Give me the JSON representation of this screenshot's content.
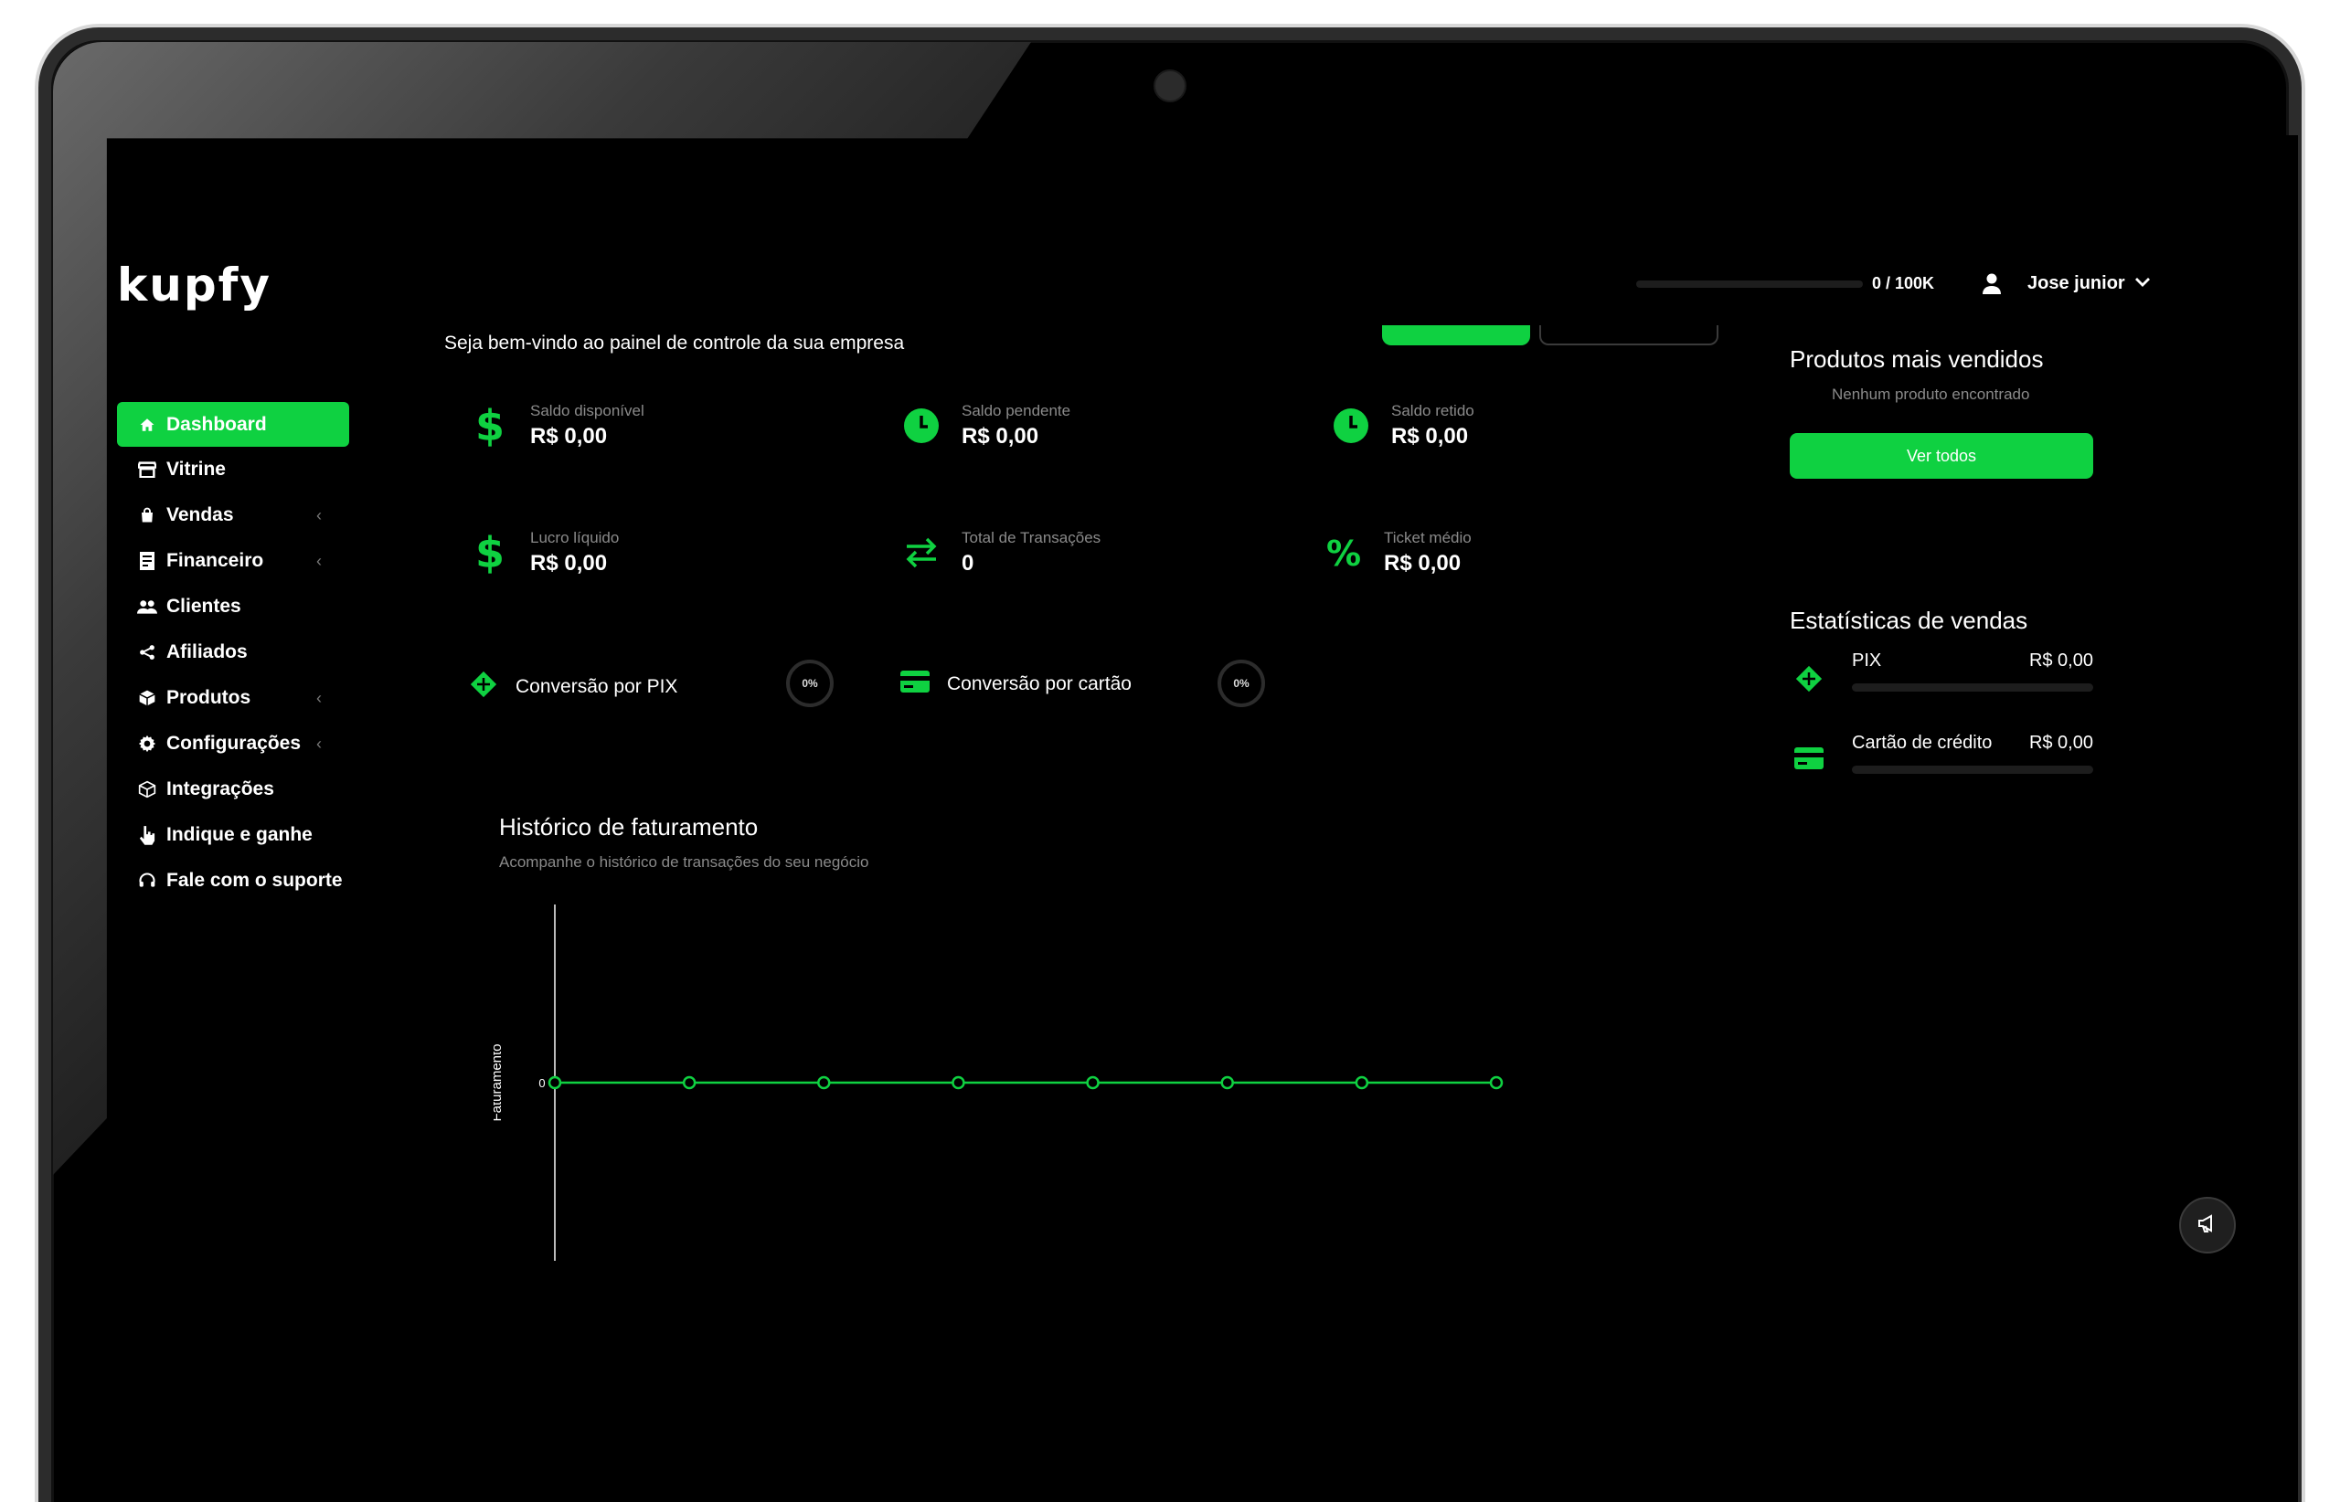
{
  "brand": {
    "logo_text": "kupfy"
  },
  "header": {
    "usage": "0 / 100K",
    "usage_fraction": 0,
    "user_name": "Jose junior"
  },
  "welcome": "Seja bem-vindo ao painel de controle da sua empresa",
  "sidebar": {
    "items": [
      {
        "label": "Dashboard",
        "icon": "home-icon",
        "active": true
      },
      {
        "label": "Vitrine",
        "icon": "store-icon"
      },
      {
        "label": "Vendas",
        "icon": "bag-icon",
        "has_submenu": true
      },
      {
        "label": "Financeiro",
        "icon": "receipt-icon",
        "has_submenu": true
      },
      {
        "label": "Clientes",
        "icon": "users-icon"
      },
      {
        "label": "Afiliados",
        "icon": "share-icon"
      },
      {
        "label": "Produtos",
        "icon": "box-icon",
        "has_submenu": true
      },
      {
        "label": "Configurações",
        "icon": "gear-icon",
        "has_submenu": true
      },
      {
        "label": "Integrações",
        "icon": "cube-icon"
      },
      {
        "label": "Indique e ganhe",
        "icon": "hand-pointer-icon"
      },
      {
        "label": "Fale com o suporte",
        "icon": "headset-icon"
      }
    ],
    "submenu_chevron": "‹"
  },
  "stats": [
    {
      "label": "Saldo disponível",
      "value": "R$ 0,00",
      "icon": "dollar-icon"
    },
    {
      "label": "Saldo pendente",
      "value": "R$ 0,00",
      "icon": "clock-icon"
    },
    {
      "label": "Saldo retido",
      "value": "R$ 0,00",
      "icon": "clock-icon"
    },
    {
      "label": "Lucro líquido",
      "value": "R$ 0,00",
      "icon": "dollar-icon"
    },
    {
      "label": "Total de Transações",
      "value": "0",
      "icon": "transfer-icon"
    },
    {
      "label": "Ticket médio",
      "value": "R$ 0,00",
      "icon": "percent-icon"
    }
  ],
  "conversions": [
    {
      "label": "Conversão por PIX",
      "percent": "0%",
      "icon": "pix-icon"
    },
    {
      "label": "Conversão por cartão",
      "percent": "0%",
      "icon": "card-icon"
    }
  ],
  "history": {
    "title": "Histórico de faturamento",
    "subtitle": "Acompanhe o histórico de transações do seu negócio"
  },
  "chart_data": {
    "type": "line",
    "x": [
      1,
      2,
      3,
      4,
      5,
      6,
      7,
      8
    ],
    "series": [
      {
        "values": [
          0,
          0,
          0,
          0,
          0,
          0,
          0,
          0
        ]
      }
    ],
    "ylabel": "Faturamento",
    "yticks": [
      "0"
    ],
    "color": "#0fd141"
  },
  "top_products": {
    "title": "Produtos mais vendidos",
    "empty_message": "Nenhum produto encontrado",
    "button": "Ver todos"
  },
  "sales_stats": {
    "title": "Estatísticas de vendas",
    "items": [
      {
        "name": "PIX",
        "value": "R$ 0,00",
        "icon": "pix-icon",
        "fraction": 0
      },
      {
        "name": "Cartão de crédito",
        "value": "R$ 0,00",
        "icon": "card-icon",
        "fraction": 0
      }
    ]
  },
  "colors": {
    "accent": "#0fd141",
    "background": "#000000",
    "muted": "#8a8a8a"
  }
}
